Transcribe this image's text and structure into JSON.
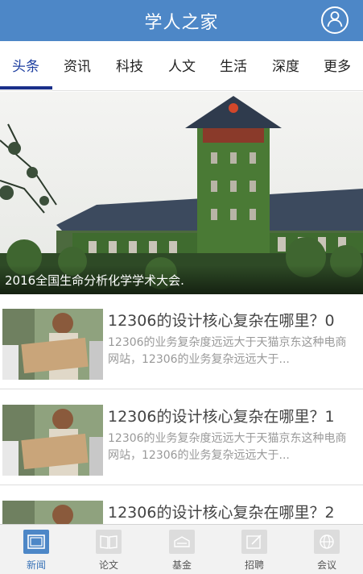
{
  "header": {
    "title": "学人之家",
    "user_icon": "user-icon"
  },
  "tabs": [
    {
      "label": "头条",
      "active": true
    },
    {
      "label": "资讯",
      "active": false
    },
    {
      "label": "科技",
      "active": false
    },
    {
      "label": "人文",
      "active": false
    },
    {
      "label": "生活",
      "active": false
    },
    {
      "label": "深度",
      "active": false
    },
    {
      "label": "更多",
      "active": false
    }
  ],
  "hero": {
    "caption": "2016全国生命分析化学学术大会."
  },
  "news": [
    {
      "title": "12306的设计核心复杂在哪里？0",
      "summary": "12306的业务复杂度远远大于天猫京东这种电商网站，12306的业务复杂远远大于..."
    },
    {
      "title": "12306的设计核心复杂在哪里？1",
      "summary": "12306的业务复杂度远远大于天猫京东这种电商网站，12306的业务复杂远远大于..."
    },
    {
      "title": "12306的设计核心复杂在哪里？2",
      "summary": ""
    }
  ],
  "bottom_nav": [
    {
      "label": "新闻",
      "icon": "news-icon",
      "active": true
    },
    {
      "label": "论文",
      "icon": "book-icon",
      "active": false
    },
    {
      "label": "基金",
      "icon": "fund-icon",
      "active": false
    },
    {
      "label": "招聘",
      "icon": "edit-icon",
      "active": false
    },
    {
      "label": "会议",
      "icon": "globe-icon",
      "active": false
    }
  ],
  "colors": {
    "header_bg": "#4d87c7",
    "tab_indicator": "#1a2f8a",
    "nav_active": "#4d87c7"
  }
}
